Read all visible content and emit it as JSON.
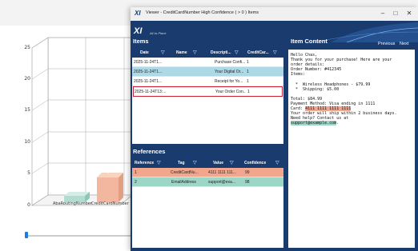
{
  "background_chart": {
    "y_ticks": [
      "25",
      "20",
      "15",
      "10",
      "5",
      "0"
    ],
    "categories": [
      "AbaRoutingNumber",
      "CreditCardNumber"
    ],
    "bar_values": [
      1,
      4
    ],
    "bar_labels": [
      "1",
      "4"
    ],
    "bar_colors": [
      "#b2dccf",
      "#f2b79e"
    ]
  },
  "window": {
    "logo": "XI",
    "title": "Viewer - CreditCardNumber High Confidence ( > 0 ) Items",
    "minimize": "–",
    "maximize": "□",
    "close": "✕",
    "brand": "XI",
    "tagline": "All-In-Place"
  },
  "items": {
    "header": "Items",
    "columns": [
      "Date",
      "Name",
      "Descripti...",
      "CreditCar..."
    ],
    "filter_icon": "▽",
    "rows": [
      {
        "date": "2025-11-24T1...",
        "name": "",
        "desc": "Purchase Confi...",
        "count": "1",
        "state": "normal"
      },
      {
        "date": "2025-11-24T1...",
        "name": "",
        "desc": "Your Digital Or...",
        "count": "1",
        "state": "selected"
      },
      {
        "date": "2025-11-24T1...",
        "name": "",
        "desc": "Receipt for Yo...",
        "count": "1",
        "state": "normal"
      },
      {
        "date": "2025-11-24T13:...",
        "name": "",
        "desc": "Your Order Con...",
        "count": "1",
        "state": "focused"
      }
    ]
  },
  "references": {
    "header": "References",
    "columns": [
      "Reference",
      "Tag",
      "Value",
      "Confidence"
    ],
    "filter_icon": "▽",
    "rows": [
      {
        "ref": "1",
        "tag": "CreditCardNu...",
        "value": "4111 1111 111...",
        "confidence": "99"
      },
      {
        "ref": "2",
        "tag": "EmailAddress",
        "value": "support@exa...",
        "confidence": "98"
      }
    ]
  },
  "item_content": {
    "header": "Item Content",
    "previous": "Previous",
    "next": "Next",
    "lines_before_card": "Hello Chas,\nThank you for your purchase! Here are your\norder details:\nOrder Number: #412345\nItems:\n\n  *  Wireless Headphones - $79.99\n  *  Shipping: $5.00\n\nTotal: $84.99\nPayment Method: Visa ending in 1111\nCard: ",
    "card_number": "4111 1111 1111 1111",
    "lines_after_card": "\nYour order will ship within 2 business days.\nNeed help? Contact us at\n",
    "email": "support@example.com",
    "email_suffix": "."
  },
  "colors": {
    "navy": "#1a3b6e",
    "selected_row": "#add8e6",
    "focus_border": "#cc2233",
    "ref_card": "#f2a68e",
    "ref_email": "#9bd6c6"
  }
}
